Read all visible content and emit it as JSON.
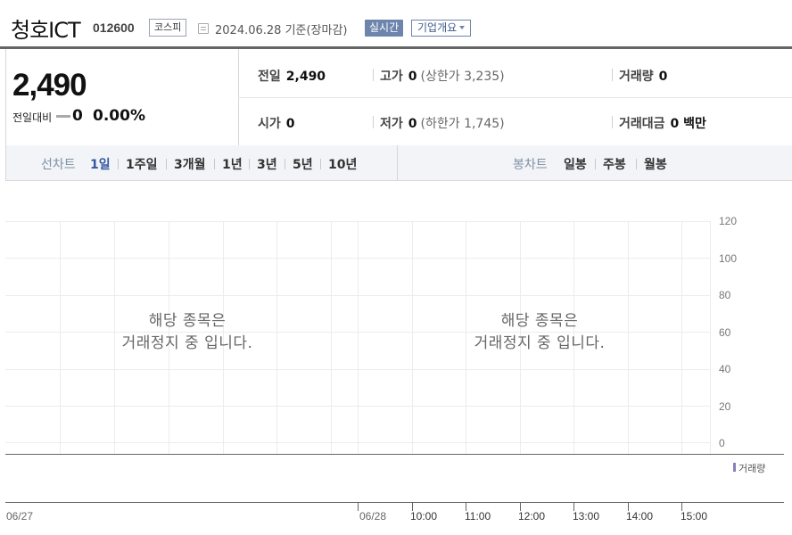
{
  "header": {
    "name": "청호ICT",
    "code": "012600",
    "market": "코스피",
    "date": "2024.06.28 기준(장마감)",
    "realtime": "실시간",
    "company_info": "기업개요"
  },
  "price": {
    "current": "2,490",
    "change_label": "전일대비",
    "change": "0",
    "change_pct": "0.00%"
  },
  "stats": {
    "prev_close_label": "전일",
    "prev_close": "2,490",
    "high_label": "고가",
    "high": "0",
    "upper_limit": "(상한가 3,235)",
    "volume_label": "거래량",
    "volume": "0",
    "open_label": "시가",
    "open": "0",
    "low_label": "저가",
    "low": "0",
    "lower_limit": "(하한가 1,745)",
    "amount_label": "거래대금",
    "amount": "0 백만"
  },
  "periods": {
    "line_label": "선차트",
    "line_items": [
      "1일",
      "1주일",
      "3개월",
      "1년",
      "3년",
      "5년",
      "10년"
    ],
    "active_index": 0,
    "candle_label": "봉차트",
    "candle_items": [
      "일봉",
      "주봉",
      "월봉"
    ]
  },
  "chart": {
    "y_ticks": [
      "120",
      "100",
      "80",
      "60",
      "40",
      "20",
      "0"
    ],
    "halt_message_line1": "해당 종목은",
    "halt_message_line2": "거래정지 중 입니다.",
    "legend": "거래량",
    "x_labels": [
      "06/27",
      "06/28",
      "10:00",
      "11:00",
      "12:00",
      "13:00",
      "14:00",
      "15:00"
    ]
  }
}
